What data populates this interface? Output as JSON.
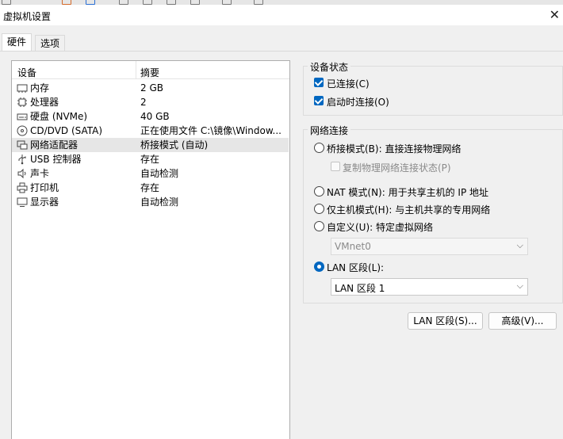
{
  "window": {
    "title": "虚拟机设置",
    "close_glyph": "✕"
  },
  "tabs": [
    {
      "label": "硬件"
    },
    {
      "label": "选项"
    }
  ],
  "device_list": {
    "header": {
      "device": "设备",
      "summary": "摘要"
    },
    "rows": [
      {
        "icon": "memory-icon",
        "name": "内存",
        "summary": "2 GB"
      },
      {
        "icon": "processor-icon",
        "name": "处理器",
        "summary": "2"
      },
      {
        "icon": "harddisk-icon",
        "name": "硬盘 (NVMe)",
        "summary": "40 GB"
      },
      {
        "icon": "cd-dvd-icon",
        "name": "CD/DVD (SATA)",
        "summary": "正在使用文件 C:\\镜像\\Window..."
      },
      {
        "icon": "network-adapter-icon",
        "name": "网络适配器",
        "summary": "桥接模式 (自动)"
      },
      {
        "icon": "usb-icon",
        "name": "USB 控制器",
        "summary": "存在"
      },
      {
        "icon": "sound-card-icon",
        "name": "声卡",
        "summary": "自动检测"
      },
      {
        "icon": "printer-icon",
        "name": "打印机",
        "summary": "存在"
      },
      {
        "icon": "display-icon",
        "name": "显示器",
        "summary": "自动检测"
      }
    ],
    "selected_index": 4
  },
  "device_status": {
    "title": "设备状态",
    "connected": {
      "label": "已连接(C)",
      "checked": true
    },
    "connect_at_power_on": {
      "label": "启动时连接(O)",
      "checked": true
    }
  },
  "network_connection": {
    "title": "网络连接",
    "bridged": {
      "label": "桥接模式(B): 直接连接物理网络",
      "selected": false
    },
    "replicate": {
      "label": "复制物理网络连接状态(P)",
      "checked": false
    },
    "nat": {
      "label": "NAT 模式(N): 用于共享主机的 IP 地址",
      "selected": false
    },
    "host_only": {
      "label": "仅主机模式(H): 与主机共享的专用网络",
      "selected": false
    },
    "custom": {
      "label": "自定义(U): 特定虚拟网络",
      "selected": false
    },
    "custom_value": "VMnet0",
    "lan_segment": {
      "label": "LAN 区段(L):",
      "selected": true
    },
    "lan_value": "LAN 区段 1"
  },
  "buttons": {
    "lan_segments": "LAN 区段(S)...",
    "advanced": "高级(V)..."
  },
  "arrow_glyph": "⌵"
}
